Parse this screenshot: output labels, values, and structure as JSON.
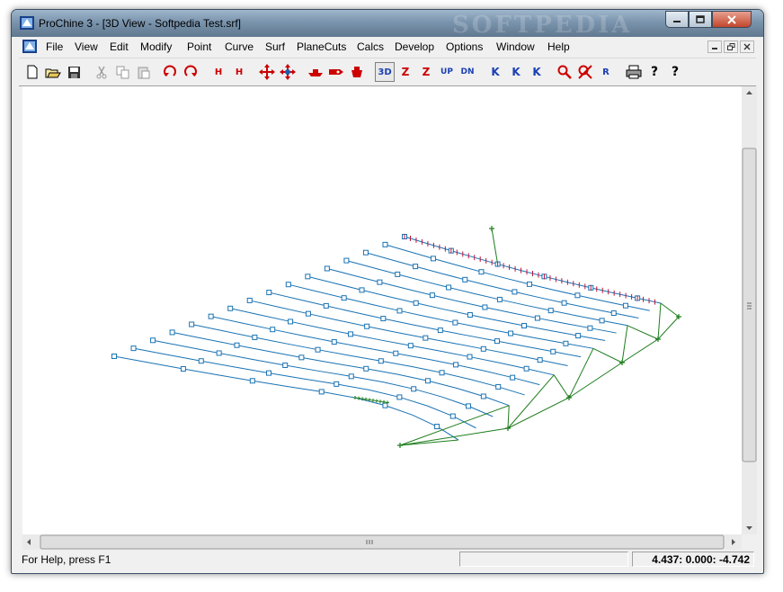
{
  "window": {
    "title": "ProChine 3 - [3D View  -  Softpedia Test.srf]",
    "watermark": "SOFTPEDIA"
  },
  "menu": {
    "items": [
      "File",
      "View",
      "Edit",
      "Modify",
      "Point",
      "Curve",
      "Surf",
      "PlaneCuts",
      "Calcs",
      "Develop",
      "Options",
      "Window",
      "Help"
    ]
  },
  "toolbar": {
    "buttons": [
      {
        "name": "new-icon",
        "label": ""
      },
      {
        "name": "open-icon",
        "label": ""
      },
      {
        "name": "save-icon",
        "label": ""
      },
      {
        "name": "cut-icon",
        "label": ""
      },
      {
        "name": "copy-icon",
        "label": ""
      },
      {
        "name": "paste-icon",
        "label": ""
      },
      {
        "name": "undo-icon",
        "label": ""
      },
      {
        "name": "redo-icon",
        "label": ""
      },
      {
        "name": "hide-icon",
        "label": "H"
      },
      {
        "name": "unhide-icon",
        "label": "H"
      },
      {
        "name": "move-icon",
        "label": ""
      },
      {
        "name": "move-points-icon",
        "label": ""
      },
      {
        "name": "top-view-icon",
        "label": ""
      },
      {
        "name": "side-view-icon",
        "label": ""
      },
      {
        "name": "front-view-icon",
        "label": ""
      },
      {
        "name": "view-3d-icon",
        "label": "3D"
      },
      {
        "name": "rotate-icon",
        "label": "Z"
      },
      {
        "name": "rotate-z-icon",
        "label": "Z"
      },
      {
        "name": "up-icon",
        "label": "UP"
      },
      {
        "name": "down-icon",
        "label": "DN"
      },
      {
        "name": "k-icon",
        "label": "K"
      },
      {
        "name": "k-up-icon",
        "label": "K"
      },
      {
        "name": "k-down-icon",
        "label": "K"
      },
      {
        "name": "zoom-icon",
        "label": ""
      },
      {
        "name": "zoom-out-icon",
        "label": ""
      },
      {
        "name": "zoom-fit-icon",
        "label": "R"
      },
      {
        "name": "print-icon",
        "label": ""
      },
      {
        "name": "help-icon",
        "label": "?"
      },
      {
        "name": "context-help-icon",
        "label": "?"
      }
    ]
  },
  "status": {
    "help_text": "For Help, press F1",
    "coords": "4.437:   0.000:  -4.742"
  },
  "colors": {
    "mesh": "#1a73b3",
    "edge_red": "#c0143c",
    "green": "#1c7d1c"
  },
  "model": {
    "rows": 16,
    "cols": 12
  }
}
